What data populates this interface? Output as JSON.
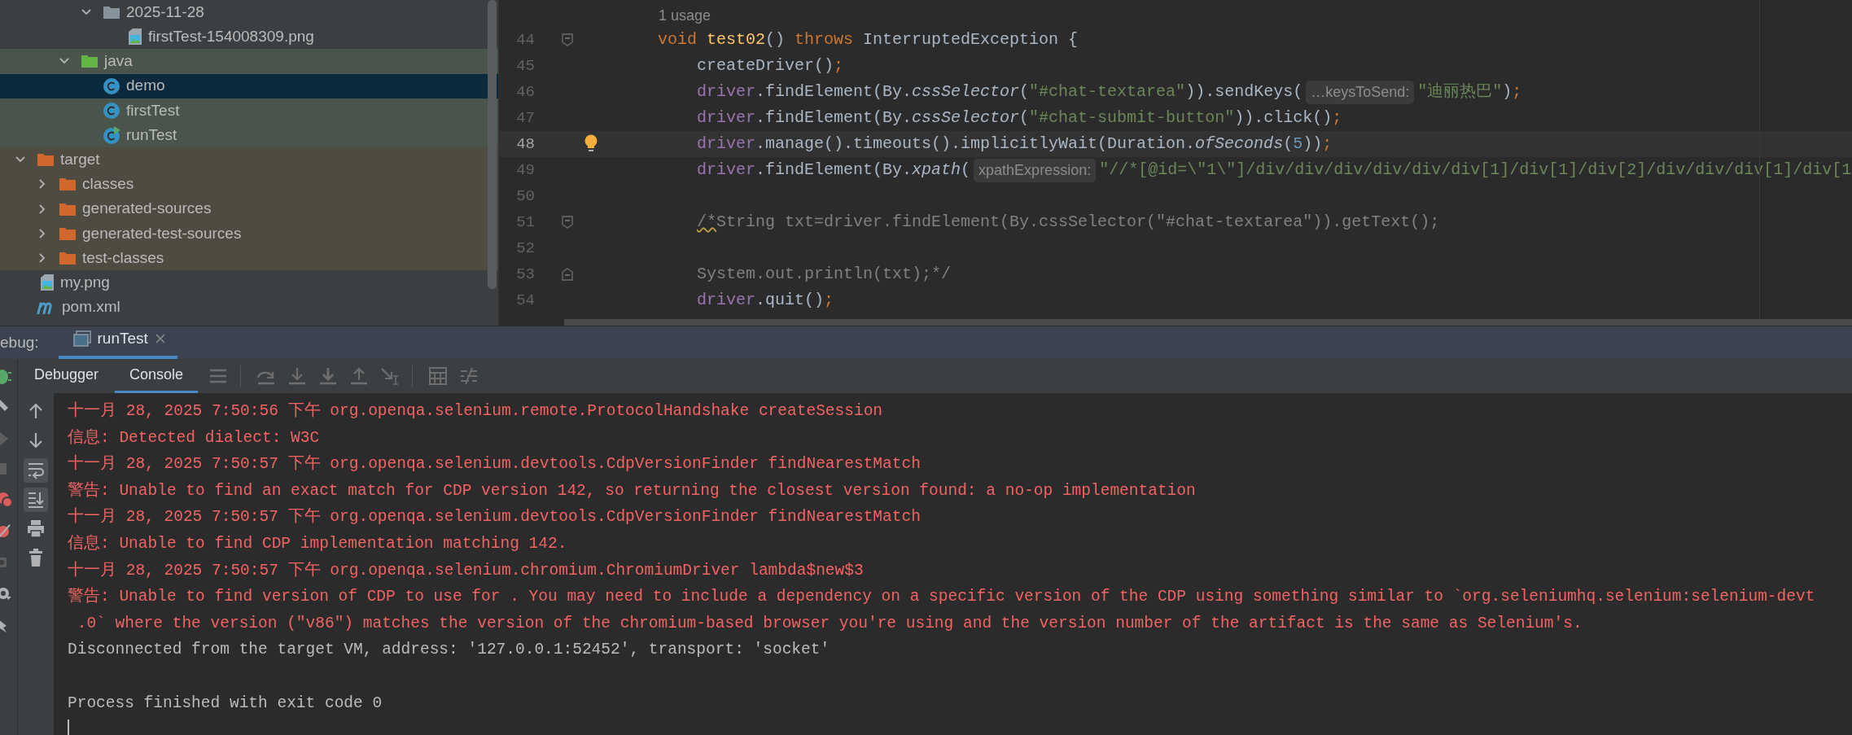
{
  "tree": [
    {
      "children": [
        {
          "children": [
            {
              "children": [
                {
                  "label": "2025-11-28",
                  "kind": "folder",
                  "expanded": true,
                  "selected": false,
                  "children": [
                    {
                      "label": "firstTest-154008309.png",
                      "kind": "image",
                      "selected": false
                    }
                  ]
                }
              ]
            },
            {
              "label": "java",
              "kind": "source-folder",
              "expanded": true,
              "selected": false,
              "test_scope": true,
              "children": [
                {
                  "label": "demo",
                  "kind": "class",
                  "selected": true
                },
                {
                  "label": "firstTest",
                  "kind": "class",
                  "selected": false,
                  "test_scope": true
                },
                {
                  "label": "runTest",
                  "kind": "runnable-class",
                  "selected": false,
                  "test_scope": true
                }
              ]
            }
          ]
        }
      ]
    },
    {
      "label": "target",
      "kind": "excluded-folder",
      "expanded": true,
      "selected": false,
      "excluded": true,
      "children": [
        {
          "label": "classes",
          "kind": "excluded-folder",
          "expanded": false,
          "selected": false,
          "excluded": true
        },
        {
          "label": "generated-sources",
          "kind": "excluded-folder",
          "expanded": false,
          "selected": false,
          "excluded": true
        },
        {
          "label": "generated-test-sources",
          "kind": "excluded-folder",
          "expanded": false,
          "selected": false,
          "excluded": true
        },
        {
          "label": "test-classes",
          "kind": "excluded-folder",
          "expanded": false,
          "selected": false,
          "excluded": true
        }
      ]
    },
    {
      "label": "my.png",
      "kind": "image",
      "selected": false
    },
    {
      "label": "pom.xml",
      "kind": "maven",
      "selected": false
    }
  ],
  "editor": {
    "usage": "1 usage",
    "lines": [
      {
        "number": "44",
        "current": false,
        "fold_start": true,
        "tokens": [
          {
            "kind": "keyword",
            "text": "void "
          },
          {
            "kind": "decl",
            "text": "test02"
          },
          {
            "kind": "plain",
            "text": "() "
          },
          {
            "kind": "keyword",
            "text": "throws"
          },
          {
            "kind": "plain",
            "text": " InterruptedException {"
          }
        ]
      },
      {
        "number": "45",
        "current": false,
        "indented": true,
        "tokens": [
          {
            "kind": "plain",
            "text": "createDriver()"
          },
          {
            "kind": "keyword",
            "text": ";"
          }
        ]
      },
      {
        "number": "46",
        "current": false,
        "indented": true,
        "tokens": [
          {
            "kind": "field",
            "text": "driver"
          },
          {
            "kind": "plain",
            "text": ".findElement(By."
          },
          {
            "kind": "static",
            "text": "cssSelector"
          },
          {
            "kind": "plain",
            "text": "("
          },
          {
            "kind": "string",
            "text": "\"#chat-textarea\""
          },
          {
            "kind": "plain",
            "text": ")).sendKeys("
          },
          {
            "kind": "hint",
            "text": "…keysToSend:"
          },
          {
            "kind": "string",
            "text": "\"迪丽热巴\""
          },
          {
            "kind": "plain",
            "text": ")"
          },
          {
            "kind": "keyword",
            "text": ";"
          }
        ]
      },
      {
        "number": "47",
        "current": false,
        "indented": true,
        "tokens": [
          {
            "kind": "field",
            "text": "driver"
          },
          {
            "kind": "plain",
            "text": ".findElement(By."
          },
          {
            "kind": "static",
            "text": "cssSelector"
          },
          {
            "kind": "plain",
            "text": "("
          },
          {
            "kind": "string",
            "text": "\"#chat-submit-button\""
          },
          {
            "kind": "plain",
            "text": ")).click()"
          },
          {
            "kind": "keyword",
            "text": ";"
          }
        ]
      },
      {
        "number": "48",
        "current": true,
        "intention": true,
        "indented": true,
        "tokens": [
          {
            "kind": "field",
            "text": "driver"
          },
          {
            "kind": "plain",
            "text": ".manage().timeouts().implicitlyWait(Duration."
          },
          {
            "kind": "static",
            "text": "ofSeconds"
          },
          {
            "kind": "plain",
            "text": "("
          },
          {
            "kind": "number",
            "text": "5"
          },
          {
            "kind": "plain",
            "text": "))"
          },
          {
            "kind": "keyword",
            "text": ";"
          }
        ]
      },
      {
        "number": "49",
        "current": false,
        "indented": true,
        "tokens": [
          {
            "kind": "field",
            "text": "driver"
          },
          {
            "kind": "plain",
            "text": ".findElement(By."
          },
          {
            "kind": "static",
            "text": "xpath"
          },
          {
            "kind": "plain",
            "text": "("
          },
          {
            "kind": "hint",
            "text": "xpathExpression:"
          },
          {
            "kind": "string",
            "text": "\"//*[@id=\\\"1\\\"]/div/div/div/div/div/div[1]/div[1]/div[2]/div/div/div[1]/div[1"
          }
        ]
      },
      {
        "number": "50",
        "current": false
      },
      {
        "number": "51",
        "current": false,
        "fold_start": true,
        "indented": true,
        "tokens": [
          {
            "kind": "flagged-comment",
            "text": "/*"
          },
          {
            "kind": "comment",
            "text": "String txt=driver.findElement(By.cssSelector(\"#chat-textarea\")).getText();"
          }
        ]
      },
      {
        "number": "52",
        "current": false
      },
      {
        "number": "53",
        "current": false,
        "fold_end": true,
        "indented": true,
        "tokens": [
          {
            "kind": "comment",
            "text": "System.out.println(txt);*/"
          }
        ]
      },
      {
        "number": "54",
        "current": false,
        "indented": true,
        "tokens": [
          {
            "kind": "field",
            "text": "driver"
          },
          {
            "kind": "plain",
            "text": ".quit()"
          },
          {
            "kind": "keyword",
            "text": ";"
          }
        ]
      }
    ]
  },
  "debug": {
    "label": "ebug:",
    "tabs": [
      {
        "label": "runTest",
        "selected": true
      }
    ],
    "subtabs": [
      {
        "label": "Debugger",
        "selected": false
      },
      {
        "label": "Console",
        "selected": true
      }
    ]
  },
  "console": {
    "tools": [
      {
        "kind": "up-arrow",
        "on": false
      },
      {
        "kind": "down-arrow",
        "on": false
      },
      {
        "kind": "soft-wrap",
        "on": true
      },
      {
        "kind": "scroll-end",
        "on": true
      },
      {
        "kind": "print",
        "on": false
      },
      {
        "kind": "trash",
        "on": false
      }
    ],
    "lines": [
      {
        "kind": "error",
        "text": "十一月 28, 2025 7:50:56 下午 org.openqa.selenium.remote.ProtocolHandshake createSession"
      },
      {
        "kind": "error",
        "text": "信息: Detected dialect: W3C"
      },
      {
        "kind": "error",
        "text": "十一月 28, 2025 7:50:57 下午 org.openqa.selenium.devtools.CdpVersionFinder findNearestMatch"
      },
      {
        "kind": "error",
        "text": "警告: Unable to find an exact match for CDP version 142, so returning the closest version found: a no-op implementation"
      },
      {
        "kind": "error",
        "text": "十一月 28, 2025 7:50:57 下午 org.openqa.selenium.devtools.CdpVersionFinder findNearestMatch"
      },
      {
        "kind": "error",
        "text": "信息: Unable to find CDP implementation matching 142."
      },
      {
        "kind": "error",
        "text": "十一月 28, 2025 7:50:57 下午 org.openqa.selenium.chromium.ChromiumDriver lambda$new$3"
      },
      {
        "kind": "error",
        "text": "警告: Unable to find version of CDP to use for . You may need to include a dependency on a specific version of the CDP using something similar to `org.seleniumhq.selenium:selenium-devt"
      },
      {
        "kind": "error",
        "text": " .0` where the version (\"v86\") matches the version of the chromium-based browser you're using and the version number of the artifact is the same as Selenium's."
      },
      {
        "kind": "normal",
        "text": "Disconnected from the target VM, address: '127.0.0.1:52452', transport: 'socket'"
      },
      {
        "kind": "blank"
      },
      {
        "kind": "normal",
        "text": "Process finished with exit code 0"
      }
    ],
    "cursor": true
  }
}
